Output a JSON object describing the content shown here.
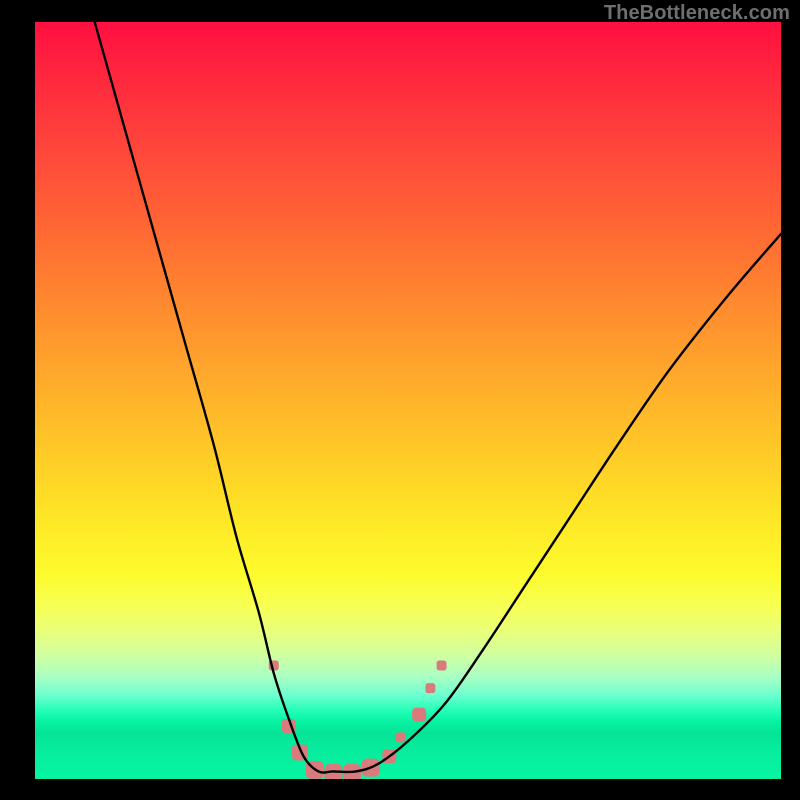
{
  "watermark": "TheBottleneck.com",
  "chart_data": {
    "type": "line",
    "title": "",
    "xlabel": "",
    "ylabel": "",
    "xlim": [
      0,
      100
    ],
    "ylim": [
      0,
      100
    ],
    "background_gradient": {
      "orientation": "vertical",
      "stops": [
        {
          "pos": 0,
          "color": "#ff0f40"
        },
        {
          "pos": 0.18,
          "color": "#ff4a3a"
        },
        {
          "pos": 0.38,
          "color": "#ff8c2f"
        },
        {
          "pos": 0.58,
          "color": "#ffce27"
        },
        {
          "pos": 0.73,
          "color": "#fdfb2d"
        },
        {
          "pos": 0.86,
          "color": "#a9ffc4"
        },
        {
          "pos": 0.93,
          "color": "#06eea0"
        },
        {
          "pos": 1.0,
          "color": "#07f5a2"
        }
      ]
    },
    "series": [
      {
        "name": "bottleneck-curve",
        "stroke": "#000000",
        "x": [
          8,
          12,
          16,
          20,
          24,
          27,
          30,
          32,
          34,
          36,
          38,
          40,
          43,
          46,
          50,
          55,
          60,
          66,
          72,
          78,
          85,
          93,
          100
        ],
        "y": [
          100,
          86,
          72,
          58,
          44,
          32,
          22,
          14,
          8,
          3,
          1,
          1,
          1,
          2,
          5,
          10,
          17,
          26,
          35,
          44,
          54,
          64,
          72
        ]
      }
    ],
    "markers": {
      "name": "highlight-points",
      "color": "#d97b7d",
      "shape": "rounded-rect",
      "points": [
        {
          "x": 32.0,
          "y": 15.0,
          "r": 5
        },
        {
          "x": 34.0,
          "y": 7.0,
          "r": 7
        },
        {
          "x": 35.5,
          "y": 3.5,
          "r": 8
        },
        {
          "x": 37.5,
          "y": 1.2,
          "r": 9
        },
        {
          "x": 40.0,
          "y": 0.8,
          "r": 9
        },
        {
          "x": 42.5,
          "y": 0.8,
          "r": 9
        },
        {
          "x": 45.0,
          "y": 1.5,
          "r": 9
        },
        {
          "x": 47.5,
          "y": 3.0,
          "r": 7
        },
        {
          "x": 49.0,
          "y": 5.5,
          "r": 5
        },
        {
          "x": 51.5,
          "y": 8.5,
          "r": 7
        },
        {
          "x": 53.0,
          "y": 12.0,
          "r": 5
        },
        {
          "x": 54.5,
          "y": 15.0,
          "r": 5
        }
      ]
    }
  }
}
